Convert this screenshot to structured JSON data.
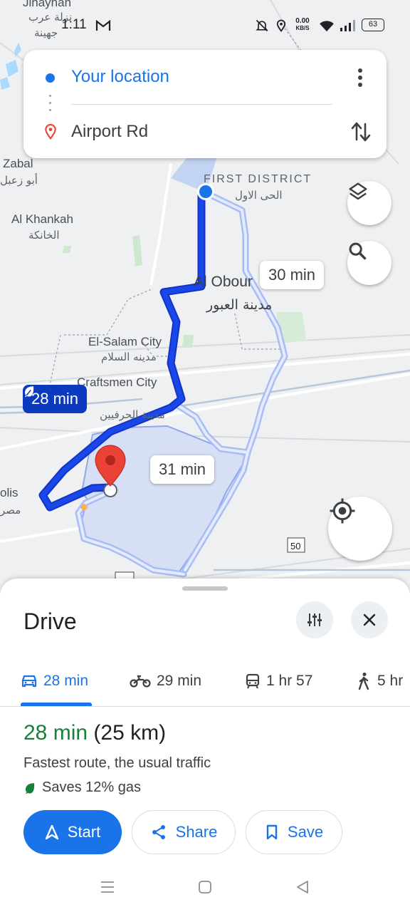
{
  "status_bar": {
    "time": "1:11",
    "net_speed_value": "0.00",
    "net_speed_unit": "KB/S",
    "battery": "63"
  },
  "route_card": {
    "origin": "Your location",
    "destination": "Airport Rd"
  },
  "map": {
    "labels": {
      "jinayhan": "Jinayhan",
      "jinayhan_ar": "نزلة عرب",
      "jinayhan_ar2": "جهينة",
      "zabal": "Zabal",
      "zabal_ar": "أبو زعبل",
      "khankah": "Al Khankah",
      "khankah_ar": "الخانكة",
      "first_district": "FIRST DISTRICT",
      "first_district_ar": "الحى الاول",
      "obour": "Al Obour",
      "obour_ar": "مدينة العبور",
      "salam": "El-Salam City",
      "salam_ar": "مدينه السلام",
      "craftsmen": "Craftsmen City",
      "craftsmen_ar": "مدينة الحرفيين",
      "olis": "olis",
      "olis_ar": "مصر",
      "road_50": "50"
    },
    "route_times": {
      "main": "28 min",
      "alt_1": "30 min",
      "alt_2": "31 min"
    },
    "colors": {
      "main_route": "#1a47e8",
      "alt_route": "#a8bdf5",
      "chip_main": "#0b3ac0",
      "destination_pin": "#ea4335"
    }
  },
  "sheet": {
    "title": "Drive",
    "modes": [
      {
        "icon": "car-icon",
        "label": "28 min",
        "active": true
      },
      {
        "icon": "motorcycle-icon",
        "label": "29 min",
        "active": false
      },
      {
        "icon": "transit-icon",
        "label": "1 hr 57",
        "active": false
      },
      {
        "icon": "walk-icon",
        "label": "5 hr",
        "active": false
      }
    ],
    "summary_time": "28 min",
    "summary_distance": "(25 km)",
    "description": "Fastest route, the usual traffic",
    "gas_note": "Saves 12% gas",
    "buttons": {
      "start": "Start",
      "share": "Share",
      "save": "Save"
    }
  }
}
